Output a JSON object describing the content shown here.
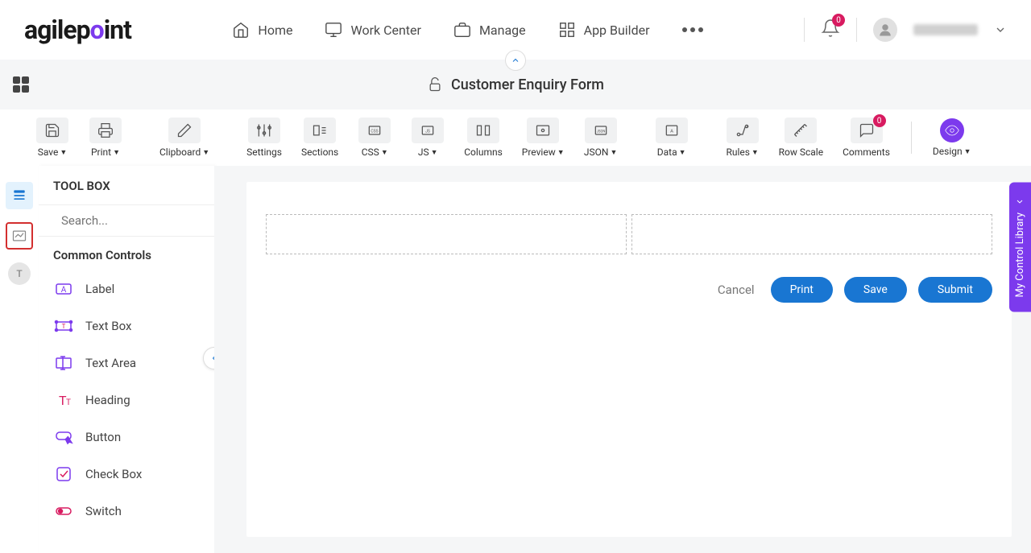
{
  "header": {
    "logo_text": "agilepoint",
    "nav": {
      "home": "Home",
      "work_center": "Work Center",
      "manage": "Manage",
      "app_builder": "App Builder"
    },
    "notif_count": "0"
  },
  "subheader": {
    "form_title": "Customer Enquiry Form"
  },
  "toolbar": {
    "save": "Save",
    "print": "Print",
    "clipboard": "Clipboard",
    "settings": "Settings",
    "sections": "Sections",
    "css": "CSS",
    "js": "JS",
    "columns": "Columns",
    "preview": "Preview",
    "json": "JSON",
    "data": "Data",
    "rules": "Rules",
    "row_scale": "Row Scale",
    "comments": "Comments",
    "comments_count": "0",
    "design": "Design"
  },
  "toolbox": {
    "title": "TOOL BOX",
    "search_placeholder": "Search...",
    "section": "Common Controls",
    "controls": {
      "label": "Label",
      "textbox": "Text Box",
      "textarea": "Text Area",
      "heading": "Heading",
      "button": "Button",
      "checkbox": "Check Box",
      "switch": "Switch"
    }
  },
  "left_rail": {
    "badge_letter": "T"
  },
  "canvas": {
    "cancel": "Cancel",
    "print": "Print",
    "save": "Save",
    "submit": "Submit"
  },
  "right_tab": {
    "label": "My Control Library"
  }
}
